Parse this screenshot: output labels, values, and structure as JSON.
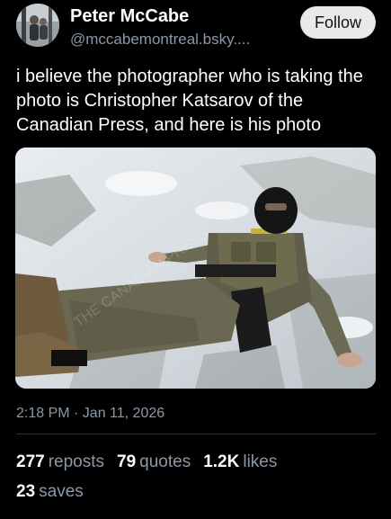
{
  "author": {
    "display_name": "Peter McCabe",
    "handle": "@mccabemontreal.bsky...."
  },
  "follow_label": "Follow",
  "post": {
    "text": "i believe the photographer who is taking the photo is Christopher Katsarov of the Canadian Press, and here is his photo",
    "timestamp": "2:18 PM · Jan 11, 2026"
  },
  "stats": {
    "reposts": {
      "count": "277",
      "label": "reposts"
    },
    "quotes": {
      "count": "79",
      "label": "quotes"
    },
    "likes": {
      "count": "1.2K",
      "label": "likes"
    },
    "saves": {
      "count": "23",
      "label": "saves"
    }
  },
  "colors": {
    "background": "#000000",
    "primary_text": "#ffffff",
    "secondary_text": "#8b98a5",
    "follow_button_bg": "#e7e9ea"
  }
}
